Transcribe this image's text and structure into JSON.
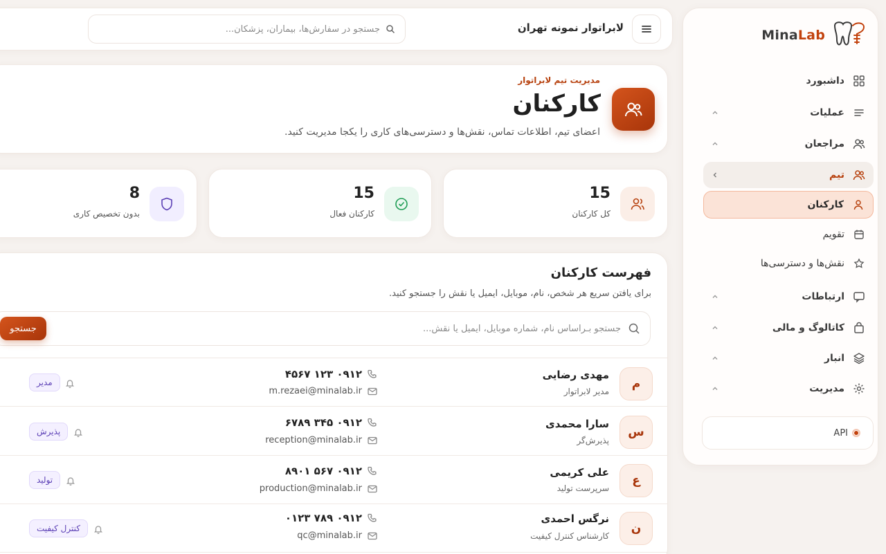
{
  "brand": {
    "name_main": "Mina",
    "name_accent": "Lab"
  },
  "header": {
    "lab_name": "لابراتوار نمونه تهران",
    "search_placeholder": "جستجو در سفارش‌ها، بیماران، پزشکان..."
  },
  "sidebar": {
    "items": [
      {
        "label": "داشبورد",
        "icon": "grid-icon"
      },
      {
        "label": "عملیات",
        "icon": "list-icon"
      },
      {
        "label": "مراجعان",
        "icon": "users-icon"
      },
      {
        "label": "تیم",
        "icon": "team-icon"
      },
      {
        "label": "کارکنان",
        "icon": "user-icon"
      },
      {
        "label": "تقویم",
        "icon": "calendar-icon"
      },
      {
        "label": "نقش‌ها و دسترسی‌ها",
        "icon": "star-icon"
      },
      {
        "label": "ارتباطات",
        "icon": "chat-icon"
      },
      {
        "label": "کاتالوگ و مالی",
        "icon": "bag-icon"
      },
      {
        "label": "انبار",
        "icon": "layers-icon"
      },
      {
        "label": "مدیریت",
        "icon": "gear-icon"
      }
    ],
    "api_label": "API"
  },
  "hero": {
    "eyebrow": "مدیریت تیم لابراتوار",
    "title": "کارکنان",
    "description": "اعضای تیم، اطلاعات تماس، نقش‌ها و دسترسی‌های کاری را یکجا مدیریت کنید."
  },
  "stats": [
    {
      "value": "15",
      "label": "کل کارکنان",
      "icon": "user-icon",
      "color": "#fbeee7"
    },
    {
      "value": "15",
      "label": "کارکنان فعال",
      "icon": "check-circle-icon",
      "color": "#e9f8ef"
    },
    {
      "value": "8",
      "label": "بدون تخصیص کاری",
      "icon": "shield-icon",
      "color": "#f1eeff"
    }
  ],
  "list": {
    "title": "فهرست کارکنان",
    "subtitle": "برای یافتن سریع هر شخص، نام، موبایل، ایمیل یا نقش را جستجو کنید.",
    "search_placeholder": "جستجو بـراساس نام، شماره موبایل، ایمیل یا نقش...",
    "search_button": "جستجو",
    "rows": [
      {
        "initial": "م",
        "name": "مهدی رضایی",
        "role": "مدیر لابراتوار",
        "phone": "۰۹۱۲ ۱۲۳ ۴۵۶۷",
        "email": "m.rezaei@minalab.ir",
        "badge": "مدیر"
      },
      {
        "initial": "س",
        "name": "سارا محمدی",
        "role": "پذیرش‌گر",
        "phone": "۰۹۱۲ ۳۴۵ ۶۷۸۹",
        "email": "reception@minalab.ir",
        "badge": "پذیرش"
      },
      {
        "initial": "ع",
        "name": "علی کریمی",
        "role": "سرپرست تولید",
        "phone": "۰۹۱۲ ۵۶۷ ۸۹۰۱",
        "email": "production@minalab.ir",
        "badge": "تولید"
      },
      {
        "initial": "ن",
        "name": "نرگس احمدی",
        "role": "کارشناس کنترل کیفیت",
        "phone": "۰۹۱۲ ۷۸۹ ۰۱۲۳",
        "email": "qc@minalab.ir",
        "badge": "کنترل کیفیت"
      }
    ]
  },
  "colors": {
    "accent": "#c2410c",
    "accent_dark": "#a8350a",
    "badge_text": "#5b3fb5"
  }
}
